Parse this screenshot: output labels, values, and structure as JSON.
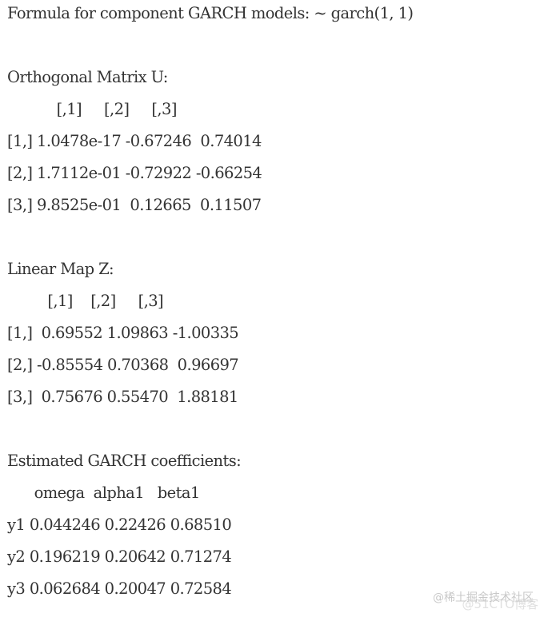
{
  "formula_line": "Formula for component GARCH models: ~ garch(1, 1)",
  "orthogonal_matrix": {
    "title": "Orthogonal Matrix U:",
    "header": "           [,1]     [,2]     [,3]",
    "rows": [
      "[1,] 1.0478e-17 -0.67246  0.74014",
      "[2,] 1.7112e-01 -0.72922 -0.66254",
      "[3,] 9.8525e-01  0.12665  0.11507"
    ]
  },
  "linear_map": {
    "title": "Linear Map Z:",
    "header": "         [,1]    [,2]     [,3]",
    "rows": [
      "[1,]  0.69552 1.09863 -1.00335",
      "[2,] -0.85554 0.70368  0.96697",
      "[3,]  0.75676 0.55470  1.88181"
    ]
  },
  "garch_coefficients": {
    "title": "Estimated GARCH coefficients:",
    "header": "      omega  alpha1   beta1",
    "rows": [
      "y1 0.044246 0.22426 0.68510",
      "y2 0.196219 0.20642 0.71274",
      "y3 0.062684 0.20047 0.72584"
    ]
  },
  "watermark": {
    "primary": "@稀土掘金技术社区",
    "secondary": "@51CTO博客"
  }
}
